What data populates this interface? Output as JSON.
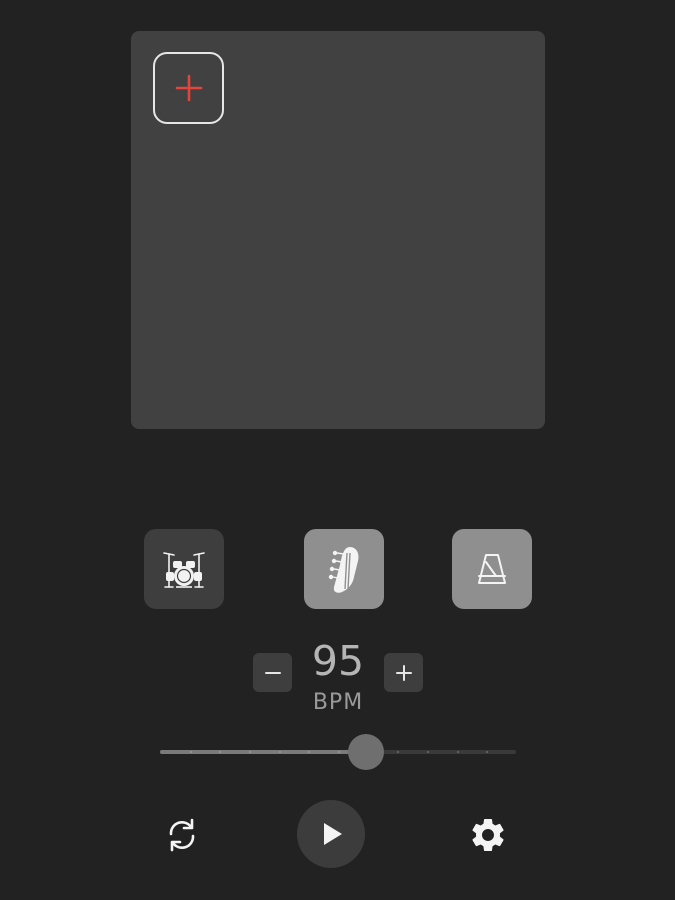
{
  "add_pattern": {
    "icon": "plus-icon",
    "color": "#e2453c"
  },
  "modes": [
    {
      "name": "drums",
      "icon": "drum-kit-icon",
      "active": false
    },
    {
      "name": "bass",
      "icon": "bass-guitar-headstock-icon",
      "active": true
    },
    {
      "name": "metronome",
      "icon": "metronome-icon",
      "active": true
    }
  ],
  "tempo": {
    "value": "95",
    "unit": "BPM",
    "decrease_icon": "minus-icon",
    "increase_icon": "plus-icon",
    "slider_fraction": 0.58
  },
  "controls": {
    "loop_icon": "sync-icon",
    "play_icon": "play-icon",
    "settings_icon": "gear-icon"
  },
  "colors": {
    "background": "#222222",
    "panel": "#414141",
    "accent": "#e2453c"
  }
}
